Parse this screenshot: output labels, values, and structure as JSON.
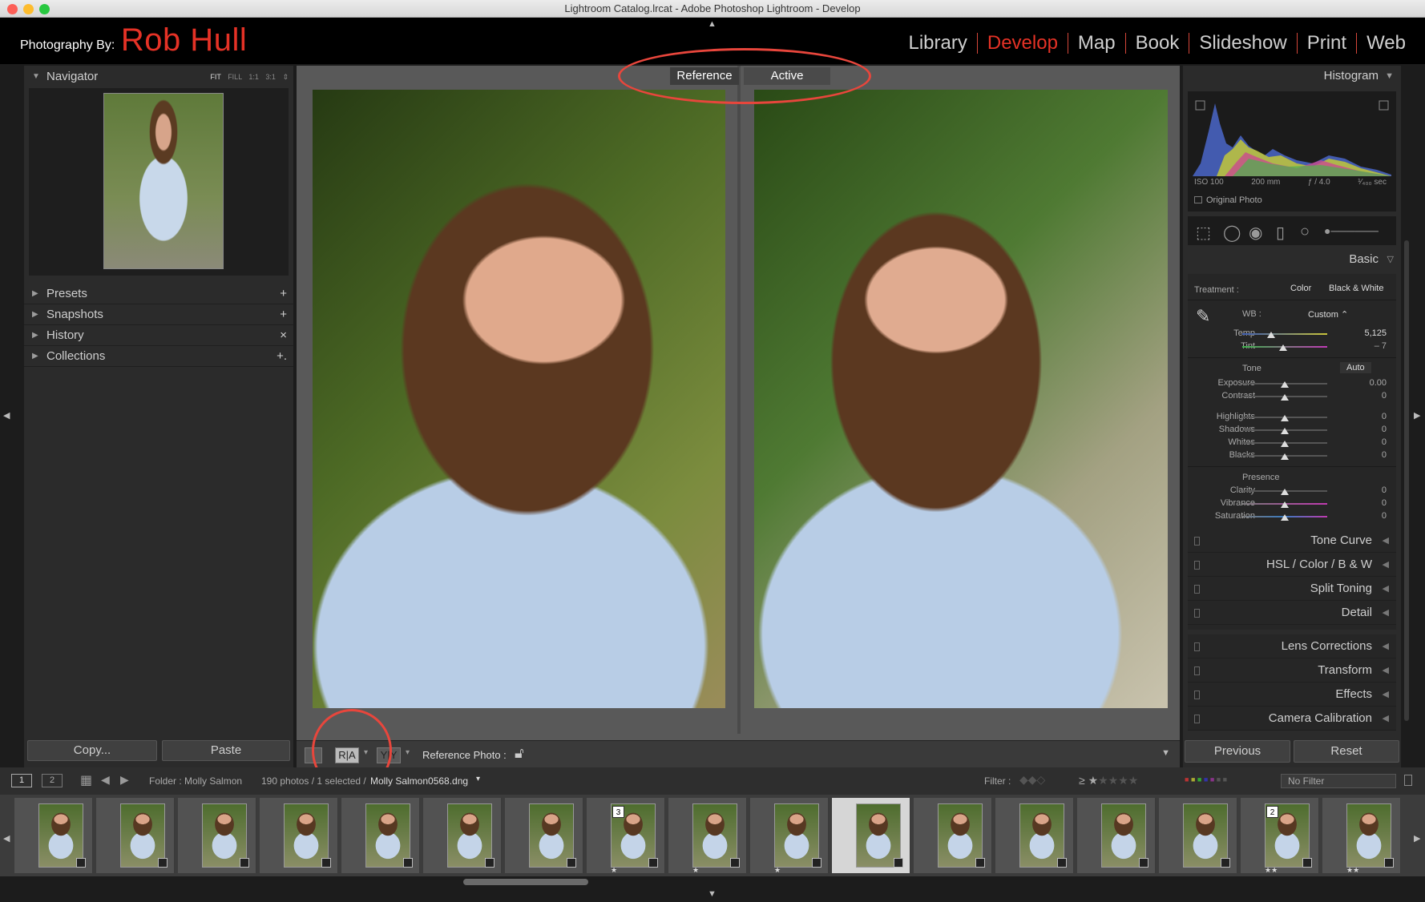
{
  "window": {
    "title": "Lightroom Catalog.lrcat - Adobe Photoshop Lightroom - Develop"
  },
  "brand": {
    "prefix": "Photography By:",
    "name": "Rob Hull"
  },
  "modules": [
    "Library",
    "Develop",
    "Map",
    "Book",
    "Slideshow",
    "Print",
    "Web"
  ],
  "active_module": "Develop",
  "left_panel": {
    "navigator": {
      "label": "Navigator",
      "zoom_fit": "FIT",
      "zoom_fill": "FILL",
      "zoom_1": "1:1",
      "zoom_3": "3:1"
    },
    "sections": [
      {
        "label": "Presets",
        "action": "+"
      },
      {
        "label": "Snapshots",
        "action": "+"
      },
      {
        "label": "History",
        "action": "×"
      },
      {
        "label": "Collections",
        "action": "+."
      }
    ],
    "copy_label": "Copy...",
    "paste_label": "Paste"
  },
  "view": {
    "reference_label": "Reference",
    "active_label": "Active"
  },
  "toolbar": {
    "ra_label": "R|A",
    "reference_photo_label": "Reference Photo :"
  },
  "right_panel": {
    "histogram": {
      "label": "Histogram",
      "iso": "ISO 100",
      "focal": "200 mm",
      "aperture": "ƒ / 4.0",
      "shutter": "¹⁄₄₀₀ sec",
      "original_photo": "Original Photo"
    },
    "basic": {
      "label": "Basic",
      "treatment_label": "Treatment :",
      "treatment_color": "Color",
      "treatment_bw": "Black & White",
      "wb_label": "WB :",
      "wb_value": "Custom ⌃",
      "temp": {
        "label": "Temp",
        "value": "5,125",
        "pos": 0.33
      },
      "tint": {
        "label": "Tint",
        "value": "– 7",
        "pos": 0.48
      },
      "tone_label": "Tone",
      "auto_label": "Auto",
      "tone_rows": [
        {
          "label": "Exposure",
          "value": "0.00"
        },
        {
          "label": "Contrast",
          "value": "0"
        },
        {
          "label": "Highlights",
          "value": "0"
        },
        {
          "label": "Shadows",
          "value": "0"
        },
        {
          "label": "Whites",
          "value": "0"
        },
        {
          "label": "Blacks",
          "value": "0"
        }
      ],
      "presence_label": "Presence",
      "presence_rows": [
        {
          "label": "Clarity",
          "value": "0"
        },
        {
          "label": "Vibrance",
          "value": "0"
        },
        {
          "label": "Saturation",
          "value": "0"
        }
      ]
    },
    "sections": [
      "Tone Curve",
      "HSL / Color / B & W",
      "Split Toning",
      "Detail",
      "Lens Corrections",
      "Transform",
      "Effects",
      "Camera Calibration"
    ],
    "previous_label": "Previous",
    "reset_label": "Reset"
  },
  "filmstrip_bar": {
    "screen1": "1",
    "screen2": "2",
    "folder": "Folder : Molly Salmon",
    "count": "190 photos / 1 selected /",
    "filename": "Molly Salmon0568.dng",
    "filter_label": "Filter :",
    "no_filter": "No Filter"
  },
  "filmstrip": [
    {
      "num": "",
      "stars": ""
    },
    {
      "num": "",
      "stars": ""
    },
    {
      "num": "",
      "stars": ""
    },
    {
      "num": "",
      "stars": ""
    },
    {
      "num": "",
      "stars": ""
    },
    {
      "num": "",
      "stars": ""
    },
    {
      "num": "",
      "stars": ""
    },
    {
      "num": "3",
      "stars": "★"
    },
    {
      "num": "",
      "stars": "★"
    },
    {
      "num": "",
      "stars": "★"
    },
    {
      "num": "",
      "stars": "",
      "selected": true
    },
    {
      "num": "",
      "stars": ""
    },
    {
      "num": "",
      "stars": ""
    },
    {
      "num": "",
      "stars": ""
    },
    {
      "num": "",
      "stars": ""
    },
    {
      "num": "2",
      "stars": "★★"
    },
    {
      "num": "",
      "stars": "★★"
    }
  ]
}
